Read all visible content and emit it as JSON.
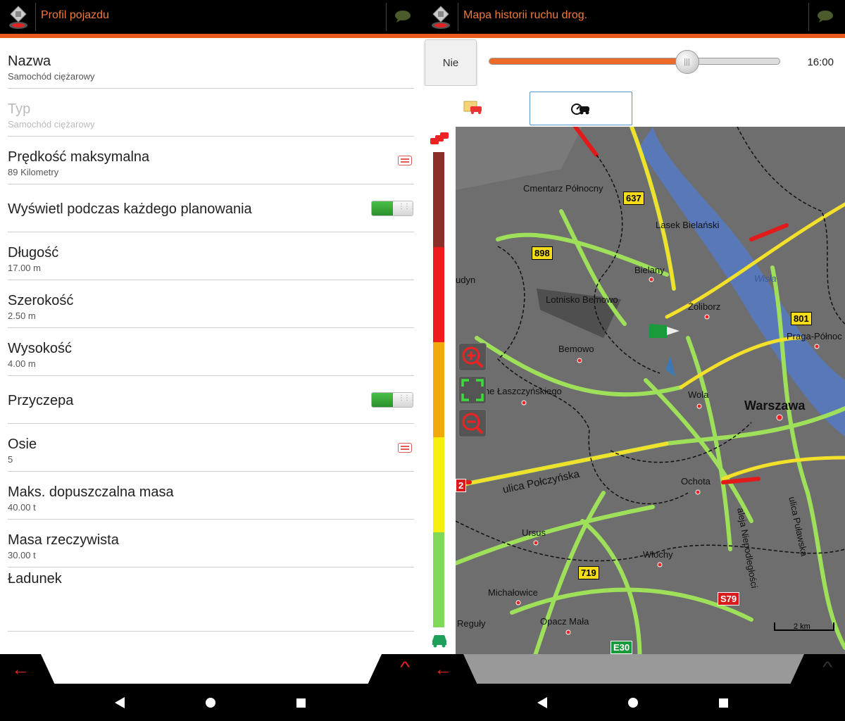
{
  "left": {
    "title": "Profil pojazdu",
    "rows": [
      {
        "title": "Nazwa",
        "sub": "Samochód ciężarowy"
      },
      {
        "title": "Typ",
        "sub": "Samochód ciężarowy"
      },
      {
        "title": "Prędkość maksymalna",
        "sub": "89 Kilometry"
      },
      {
        "title": "Wyświetl podczas każdego planowania"
      },
      {
        "title": "Długość",
        "sub": "17.00 m"
      },
      {
        "title": "Szerokość",
        "sub": "2.50 m"
      },
      {
        "title": "Wysokość",
        "sub": "4.00 m"
      },
      {
        "title": "Przyczepa"
      },
      {
        "title": "Osie",
        "sub": "5"
      },
      {
        "title": "Maks. dopuszczalna masa",
        "sub": "40.00 t"
      },
      {
        "title": "Masa rzeczywista",
        "sub": "30.00 t"
      },
      {
        "title": "Ładunek"
      }
    ],
    "toggles": {
      "planning_on": true,
      "trailer_on": true
    }
  },
  "right": {
    "title": "Mapa historii ruchu drog.",
    "no_button": "Nie",
    "slider_time": "16:00",
    "slider_fraction": 0.68,
    "map_labels": {
      "cmentarz": "Cmentarz Północny",
      "lasek": "Lasek Bielański",
      "bielany": "Bielany",
      "lotnisko": "Lotnisko Bemowo",
      "zoliborz": "Żoliborz",
      "wisla": "Wisła",
      "praga": "Praga-Północ",
      "bemowo": "Bemowo",
      "blizne": "Blizne Łaszczyńskiego",
      "wola": "Wola",
      "warszawa": "Warszawa",
      "polczynska": "ulica Połczyńska",
      "ochota": "Ochota",
      "niepodleglosci": "aleja Niepodległości",
      "pulawska": "ulica Puławska",
      "ursus": "Ursus",
      "wlochy": "Włochy",
      "michalowice": "Michałowice",
      "opacz": "Opacz Mała",
      "reguly": "Reguły",
      "udyn": "udyn"
    },
    "shields": {
      "r637": "637",
      "r898": "898",
      "r801": "801",
      "r719": "719",
      "s79": "S79",
      "e30": "E30",
      "r2": "2"
    },
    "scale_label": "2 km"
  },
  "colors": {
    "accent": "#ea5a1f",
    "title_text": "#f07a3a",
    "danger": "#e02424",
    "toggle_on": "#2b8f2b"
  }
}
